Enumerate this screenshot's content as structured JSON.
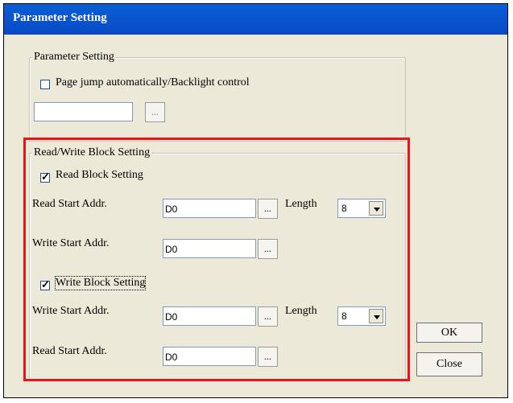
{
  "window": {
    "title": "Parameter Setting"
  },
  "param_group": {
    "legend": "Parameter Setting",
    "checkbox_label": "Page jump automatically/Backlight control",
    "checkbox_checked": false,
    "input_value": "",
    "browse_label": "..."
  },
  "rw_group": {
    "legend": "Read/Write Block Setting",
    "read_block": {
      "label": "Read Block Setting",
      "checked": true,
      "read_start_label": "Read Start Addr.",
      "read_start_value": "D0",
      "length_label": "Length",
      "length_value": "8",
      "write_start_label": "Write Start Addr.",
      "write_start_value": "D0"
    },
    "write_block": {
      "label": "Write Block Setting",
      "checked": true,
      "write_start_label": "Write Start Addr.",
      "write_start_value": "D0",
      "length_label": "Length",
      "length_value": "8",
      "read_start_label": "Read Start Addr.",
      "read_start_value": "D0"
    },
    "browse_label": "..."
  },
  "buttons": {
    "ok": "OK",
    "close": "Close"
  },
  "colors": {
    "highlight_box": "#e8131b",
    "title_bar": "#0a5fd6",
    "dialog_bg": "#ece9d8"
  }
}
